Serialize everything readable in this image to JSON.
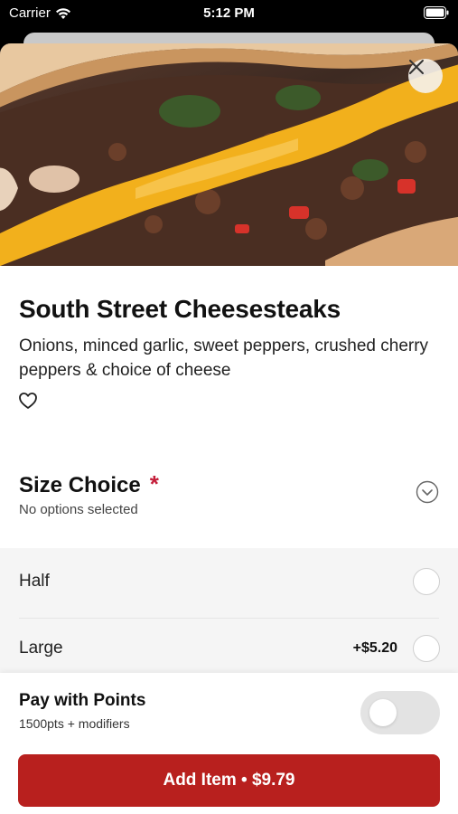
{
  "status_bar": {
    "carrier": "Carrier",
    "time": "5:12 PM"
  },
  "product": {
    "title": "South Street Cheesesteaks",
    "description": "Onions, minced garlic, sweet peppers, crushed cherry peppers & choice of cheese"
  },
  "size_choice": {
    "heading": "Size Choice",
    "required_marker": "*",
    "status": "No options selected",
    "options": [
      {
        "label": "Half",
        "price": ""
      },
      {
        "label": "Large",
        "price": "+$5.20"
      }
    ]
  },
  "points": {
    "title": "Pay with Points",
    "subtitle": "1500pts + modifiers",
    "enabled": false
  },
  "add_button": {
    "label": "Add Item • $9.79"
  },
  "icons": {
    "close": "close-icon",
    "favorite": "heart-outline-icon",
    "expand": "chevron-down-circle-icon",
    "wifi": "wifi-icon",
    "battery": "battery-icon"
  },
  "colors": {
    "accent": "#b8201e",
    "required": "#c41e3a"
  }
}
